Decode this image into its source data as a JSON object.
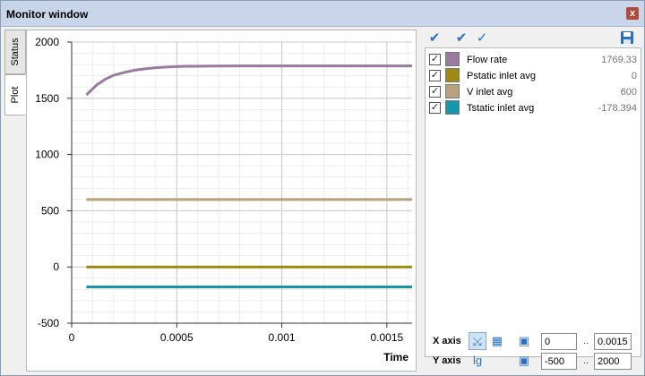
{
  "window": {
    "title": "Monitor window",
    "close_glyph": "x"
  },
  "tabs": [
    {
      "label": "Status",
      "active": false
    },
    {
      "label": "Plot",
      "active": true
    }
  ],
  "toolbar": {
    "icons": [
      "check-all-icon",
      "check-icon",
      "uncheck-icon",
      "save-icon"
    ]
  },
  "legend": [
    {
      "label": "Flow rate",
      "value": "1769.33",
      "color": "#9b7aa0",
      "checked": true
    },
    {
      "label": "Pstatic inlet avg",
      "value": "0",
      "color": "#9c8a14",
      "checked": true
    },
    {
      "label": "V inlet avg",
      "value": "600",
      "color": "#b8a27e",
      "checked": true
    },
    {
      "label": "Tstatic inlet avg",
      "value": "-178.394",
      "color": "#1696a8",
      "checked": true
    }
  ],
  "axes": {
    "x": {
      "label": "X axis",
      "min": "0",
      "max": "0.0015"
    },
    "y": {
      "label": "Y axis",
      "min": "-500",
      "max": "2000"
    },
    "range_sep": ".."
  },
  "chart_data": {
    "type": "line",
    "xlabel": "Time",
    "ylabel": "",
    "xlim": [
      0,
      0.00162
    ],
    "ylim": [
      -500,
      2000
    ],
    "x_ticks": [
      0,
      0.0005,
      0.001,
      0.0015
    ],
    "x_tick_labels": [
      "0",
      "0.0005",
      "0.001",
      "0.0015"
    ],
    "y_ticks": [
      -500,
      0,
      500,
      1000,
      1500,
      2000
    ],
    "y_tick_labels": [
      "-500",
      "0",
      "500",
      "1000",
      "1500",
      "2000"
    ],
    "grid": true,
    "series": [
      {
        "name": "Flow rate",
        "color": "#9b7aa0",
        "x": [
          7e-05,
          0.00012,
          0.00016,
          0.0002,
          0.00025,
          0.0003,
          0.00035,
          0.0004,
          0.00045,
          0.0005,
          0.00055,
          0.0006,
          0.0007,
          0.0008,
          0.0009,
          0.001,
          0.0011,
          0.0012,
          0.0013,
          0.0014,
          0.0015,
          0.00162
        ],
        "y": [
          1530,
          1620,
          1670,
          1705,
          1730,
          1750,
          1762,
          1772,
          1778,
          1782,
          1785,
          1785,
          1787,
          1788,
          1788,
          1788,
          1788,
          1788,
          1788,
          1788,
          1788,
          1788
        ]
      },
      {
        "name": "V inlet avg",
        "color": "#b8a27e",
        "x": [
          7e-05,
          0.00162
        ],
        "y": [
          600,
          600
        ]
      },
      {
        "name": "Pstatic inlet avg",
        "color": "#9c8a14",
        "x": [
          7e-05,
          0.00162
        ],
        "y": [
          0,
          0
        ]
      },
      {
        "name": "Tstatic inlet avg",
        "color": "#1696a8",
        "x": [
          7e-05,
          0.00162
        ],
        "y": [
          -178,
          -178
        ]
      }
    ]
  }
}
